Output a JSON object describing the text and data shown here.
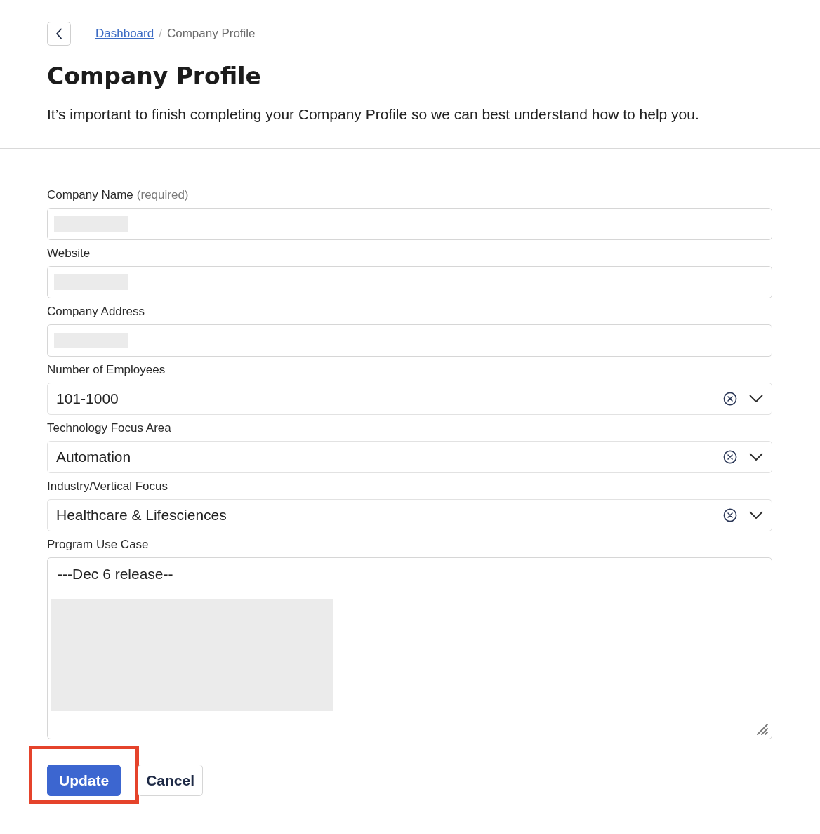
{
  "header": {
    "breadcrumb": [
      {
        "label": "Dashboard",
        "kind": "link"
      },
      {
        "label": "Company Profile",
        "kind": "current"
      }
    ],
    "separator": "/",
    "title": "Company Profile",
    "description": "It’s important to finish completing your Company Profile so we can best understand how to help you."
  },
  "form": {
    "fields": [
      {
        "label": "Company Name",
        "hint": "(required)",
        "kind": "text",
        "redacted": true
      },
      {
        "label": "Website",
        "kind": "text",
        "redacted": true
      },
      {
        "label": "Company Address",
        "kind": "text",
        "redacted": true
      },
      {
        "label": "Number of Employees",
        "kind": "select",
        "value": "101-1000",
        "clearable": true
      },
      {
        "label": "Technology Focus Area",
        "kind": "select",
        "value": "Automation",
        "clearable": true
      },
      {
        "label": "Industry/Vertical Focus",
        "kind": "select",
        "value": "Healthcare & Lifesciences",
        "clearable": true
      },
      {
        "label": "Program Use Case",
        "kind": "textarea",
        "value": "---Dec 6 release--",
        "redacted": true
      }
    ]
  },
  "buttons": [
    {
      "label": "Update",
      "kind": "primary",
      "highlighted": true
    },
    {
      "label": "Cancel",
      "kind": "secondary",
      "highlighted": false
    }
  ]
}
